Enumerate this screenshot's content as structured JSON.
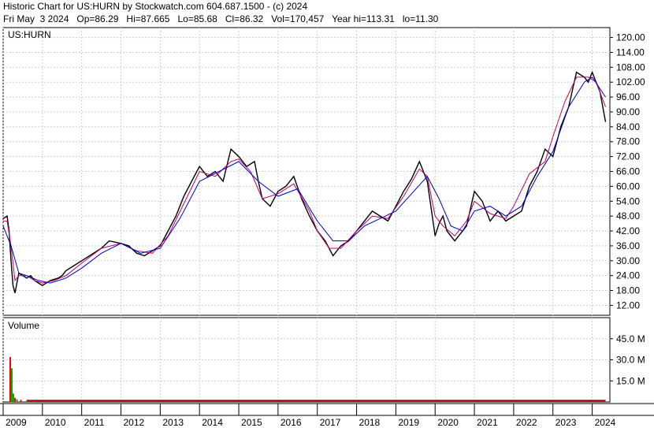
{
  "header": {
    "line1": "Historic Chart for US:HURN by Stockwatch.com 604.687.1500 - (c) 2024",
    "line2": "Fri May  3 2024   Op=86.29   Hi=87.665   Lo=85.68   Cl=86.32   Vol=170,457   Year hi=113.31   lo=11.30"
  },
  "chart_data": [
    {
      "type": "line",
      "panel": "price",
      "title": "US:HURN",
      "ylim": [
        8,
        124
      ],
      "yticks": [
        12,
        18,
        24,
        30,
        36,
        42,
        48,
        54,
        60,
        66,
        72,
        78,
        84,
        90,
        96,
        102,
        108,
        114,
        120
      ],
      "ytick_labels": [
        "12.00",
        "18.00",
        "24.00",
        "30.00",
        "36.00",
        "42.00",
        "48.00",
        "54.00",
        "60.00",
        "66.00",
        "72.00",
        "78.00",
        "84.00",
        "90.00",
        "96.00",
        "102.00",
        "108.00",
        "114.00",
        "120.00"
      ],
      "xlim": [
        2009.0,
        2024.45
      ],
      "grid": true,
      "series": [
        {
          "kind": "close",
          "color": "#000000",
          "x": [
            2009.0,
            2009.1,
            2009.15,
            2009.2,
            2009.25,
            2009.3,
            2009.4,
            2009.5,
            2009.6,
            2009.7,
            2009.8,
            2009.9,
            2010.0,
            2010.2,
            2010.4,
            2010.5,
            2010.6,
            2010.8,
            2011.0,
            2011.3,
            2011.5,
            2011.7,
            2012.0,
            2012.2,
            2012.4,
            2012.6,
            2012.8,
            2013.0,
            2013.2,
            2013.4,
            2013.6,
            2013.8,
            2014.0,
            2014.2,
            2014.4,
            2014.6,
            2014.8,
            2015.0,
            2015.2,
            2015.4,
            2015.5,
            2015.6,
            2015.8,
            2016.0,
            2016.2,
            2016.4,
            2016.6,
            2016.8,
            2017.0,
            2017.2,
            2017.4,
            2017.6,
            2017.8,
            2018.0,
            2018.2,
            2018.4,
            2018.6,
            2018.8,
            2019.0,
            2019.2,
            2019.4,
            2019.6,
            2019.8,
            2020.0,
            2020.1,
            2020.2,
            2020.3,
            2020.5,
            2020.8,
            2021.0,
            2021.2,
            2021.4,
            2021.6,
            2021.8,
            2022.0,
            2022.2,
            2022.4,
            2022.6,
            2022.8,
            2023.0,
            2023.2,
            2023.4,
            2023.6,
            2023.8,
            2023.9,
            2024.0,
            2024.2,
            2024.34
          ],
          "y": [
            47,
            48,
            42,
            30,
            20,
            17,
            25,
            24,
            23,
            24,
            22,
            21,
            20,
            22,
            23,
            24,
            26,
            28,
            30,
            33,
            35,
            38,
            37,
            36,
            33,
            32,
            34,
            36,
            42,
            48,
            56,
            62,
            68,
            64,
            66,
            62,
            75,
            72,
            68,
            70,
            62,
            55,
            52,
            58,
            60,
            64,
            55,
            48,
            42,
            38,
            32,
            36,
            38,
            42,
            46,
            50,
            48,
            46,
            52,
            58,
            63,
            70,
            62,
            40,
            45,
            48,
            42,
            38,
            44,
            58,
            54,
            46,
            50,
            46,
            48,
            50,
            60,
            66,
            75,
            72,
            84,
            92,
            106,
            104,
            102,
            106,
            98,
            86
          ]
        },
        {
          "kind": "short_ma",
          "color": "#c0006a",
          "x": [
            2009.0,
            2009.1,
            2009.2,
            2009.3,
            2009.4,
            2009.6,
            2009.8,
            2010.0,
            2010.3,
            2010.6,
            2011.0,
            2011.5,
            2012.0,
            2012.4,
            2012.8,
            2013.2,
            2013.6,
            2014.0,
            2014.4,
            2014.8,
            2015.0,
            2015.3,
            2015.6,
            2016.0,
            2016.4,
            2016.8,
            2017.0,
            2017.3,
            2017.6,
            2018.0,
            2018.4,
            2018.8,
            2019.2,
            2019.6,
            2019.8,
            2020.0,
            2020.2,
            2020.5,
            2020.8,
            2021.0,
            2021.4,
            2021.8,
            2022.0,
            2022.4,
            2022.8,
            2023.0,
            2023.3,
            2023.6,
            2023.9,
            2024.1,
            2024.34
          ],
          "y": [
            46,
            46,
            36,
            22,
            24,
            24,
            22,
            21,
            22,
            24,
            29,
            35,
            37,
            34,
            33,
            40,
            53,
            66,
            64,
            70,
            71,
            66,
            55,
            57,
            61,
            50,
            42,
            35,
            35,
            42,
            48,
            47,
            56,
            67,
            64,
            48,
            44,
            40,
            46,
            54,
            49,
            47,
            52,
            65,
            70,
            80,
            94,
            104,
            104,
            102,
            92
          ]
        },
        {
          "kind": "long_ma",
          "color": "#0000cc",
          "x": [
            2009.0,
            2009.2,
            2009.4,
            2009.6,
            2009.9,
            2010.2,
            2010.6,
            2011.0,
            2011.5,
            2012.0,
            2012.5,
            2013.0,
            2013.5,
            2014.0,
            2014.5,
            2015.0,
            2015.5,
            2016.0,
            2016.5,
            2017.0,
            2017.4,
            2017.8,
            2018.2,
            2018.6,
            2019.0,
            2019.4,
            2019.8,
            2020.1,
            2020.4,
            2020.7,
            2021.0,
            2021.4,
            2021.8,
            2022.2,
            2022.6,
            2023.0,
            2023.4,
            2023.8,
            2024.0,
            2024.34
          ],
          "y": [
            44,
            36,
            25,
            24,
            22,
            21,
            23,
            27,
            33,
            37,
            33,
            35,
            47,
            62,
            66,
            70,
            62,
            56,
            59,
            46,
            38,
            38,
            44,
            47,
            50,
            57,
            64,
            55,
            44,
            42,
            50,
            52,
            48,
            52,
            64,
            74,
            92,
            102,
            104,
            96
          ]
        }
      ],
      "xtick_labels": [
        "2009",
        "2010",
        "2011",
        "2012",
        "2013",
        "2014",
        "2015",
        "2016",
        "2017",
        "2018",
        "2019",
        "2020",
        "2021",
        "2022",
        "2023",
        "2024"
      ],
      "xtick_values": [
        2009.0,
        2010.0,
        2011.0,
        2012.0,
        2013.0,
        2014.0,
        2015.0,
        2016.0,
        2017.0,
        2018.0,
        2019.0,
        2020.0,
        2021.0,
        2022.0,
        2023.0,
        2024.0
      ]
    },
    {
      "type": "bar",
      "panel": "volume",
      "title": "Volume",
      "ylim": [
        0,
        60
      ],
      "yticks": [
        15,
        30,
        45
      ],
      "ytick_labels": [
        "15.0 M",
        "30.0 M",
        "45.0 M"
      ],
      "x": [
        2009.18,
        2009.22,
        2009.26,
        2009.3,
        2009.35,
        2009.45,
        2009.6
      ],
      "values": [
        32,
        24,
        6,
        3,
        2,
        1.5,
        1
      ],
      "colors": [
        "#ff0000",
        "#00aa00",
        "#00aa00",
        "#ff0000",
        "#00aa00",
        "#ff0000",
        "#00aa00"
      ],
      "baseline_level": 1
    }
  ]
}
